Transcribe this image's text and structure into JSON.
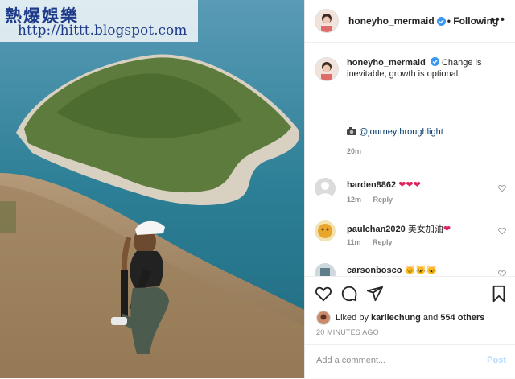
{
  "watermark": {
    "line1": "熱爆娛樂",
    "line2": "http://hittt.blogspot.com"
  },
  "header": {
    "username": "honeyho_mermaid",
    "follow_label": "• Following",
    "more_icon": "more-dots-icon"
  },
  "caption": {
    "username": "honeyho_mermaid",
    "text": "Change is inevitable, growth is optional.",
    "dots": [
      ".",
      ".",
      ".",
      "."
    ],
    "camera_icon": "camera-emoji-icon",
    "mention": "@journeythroughlight",
    "time": "20m"
  },
  "comments": [
    {
      "username": "harden8862",
      "text": "",
      "emoji": "heart-emoji-x3",
      "time": "12m",
      "reply": "Reply"
    },
    {
      "username": "paulchan2020",
      "text": "美女加油",
      "emoji": "heart-emoji",
      "time": "11m",
      "reply": "Reply"
    },
    {
      "username": "carsonbosco",
      "text": "",
      "emoji": "cat-emoji-x3",
      "time": "",
      "reply": ""
    }
  ],
  "actions": {
    "liked_prefix": "Liked by",
    "liked_user": "karliechung",
    "liked_and": "and",
    "liked_others": "554 others",
    "timestamp": "20 MINUTES AGO"
  },
  "add_comment": {
    "placeholder": "Add a comment...",
    "post_label": "Post"
  },
  "colors": {
    "verified": "#3897f0",
    "post_disabled": "#b3dbff",
    "emoji_red": "#e0245e"
  }
}
